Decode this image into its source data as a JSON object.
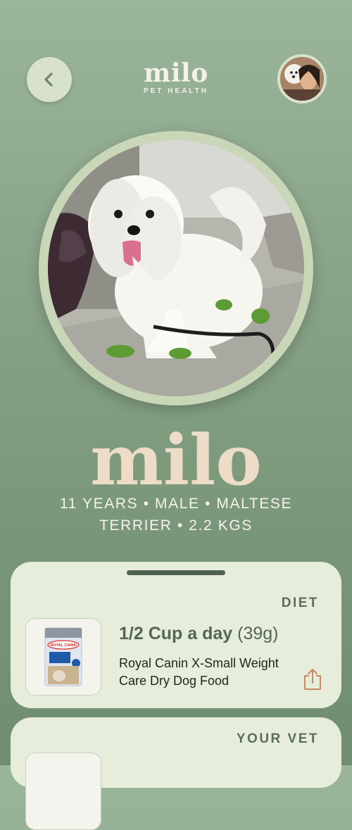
{
  "header": {
    "brand_name": "milo",
    "brand_subtitle": "PET HEALTH",
    "back_icon": "chevron-left-icon"
  },
  "pet": {
    "name": "milo",
    "info": "11 YEARS • MALE • MALTESE TERRIER • 2.2 KGS"
  },
  "diet_card": {
    "title": "DIET",
    "amount": "1/2 Cup a day",
    "grams": "(39g)",
    "food_name": "Royal Canin X-Small Weight Care Dry Dog Food",
    "product_brand_text": "ROYAL CANIN",
    "share_icon": "share-icon"
  },
  "vet_card": {
    "title": "YOUR VET"
  },
  "colors": {
    "background": "#7f9a7e",
    "card": "#e6eedb",
    "accent_name": "#ecdcc8",
    "share_icon": "#c98a5e"
  }
}
